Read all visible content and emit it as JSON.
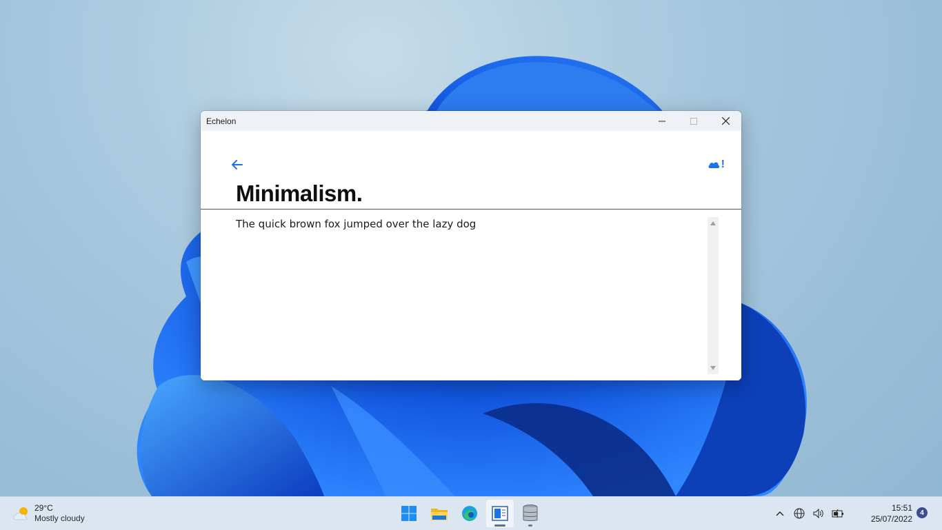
{
  "window": {
    "title": "Echelon",
    "caption": {
      "minimize": "minimize",
      "maximize": "maximize",
      "close": "close"
    }
  },
  "page": {
    "title": "Minimalism.",
    "body_text": "The quick brown fox jumped over the lazy dog",
    "sync_mark": "!"
  },
  "taskbar": {
    "weather": {
      "temp": "29°C",
      "desc": "Mostly cloudy"
    },
    "apps": [
      {
        "name": "start",
        "icon": "windows-logo-icon"
      },
      {
        "name": "file-explorer",
        "icon": "folder-icon"
      },
      {
        "name": "edge",
        "icon": "edge-icon"
      },
      {
        "name": "echelon",
        "icon": "notepad-icon",
        "active": true
      },
      {
        "name": "database",
        "icon": "database-icon"
      }
    ],
    "clock": {
      "time": "15:51",
      "date": "25/07/2022"
    },
    "notifications": "4"
  },
  "colors": {
    "accent": "#1a73e8",
    "taskbar": "#dce6f1",
    "titlebar": "#eef2f6"
  }
}
